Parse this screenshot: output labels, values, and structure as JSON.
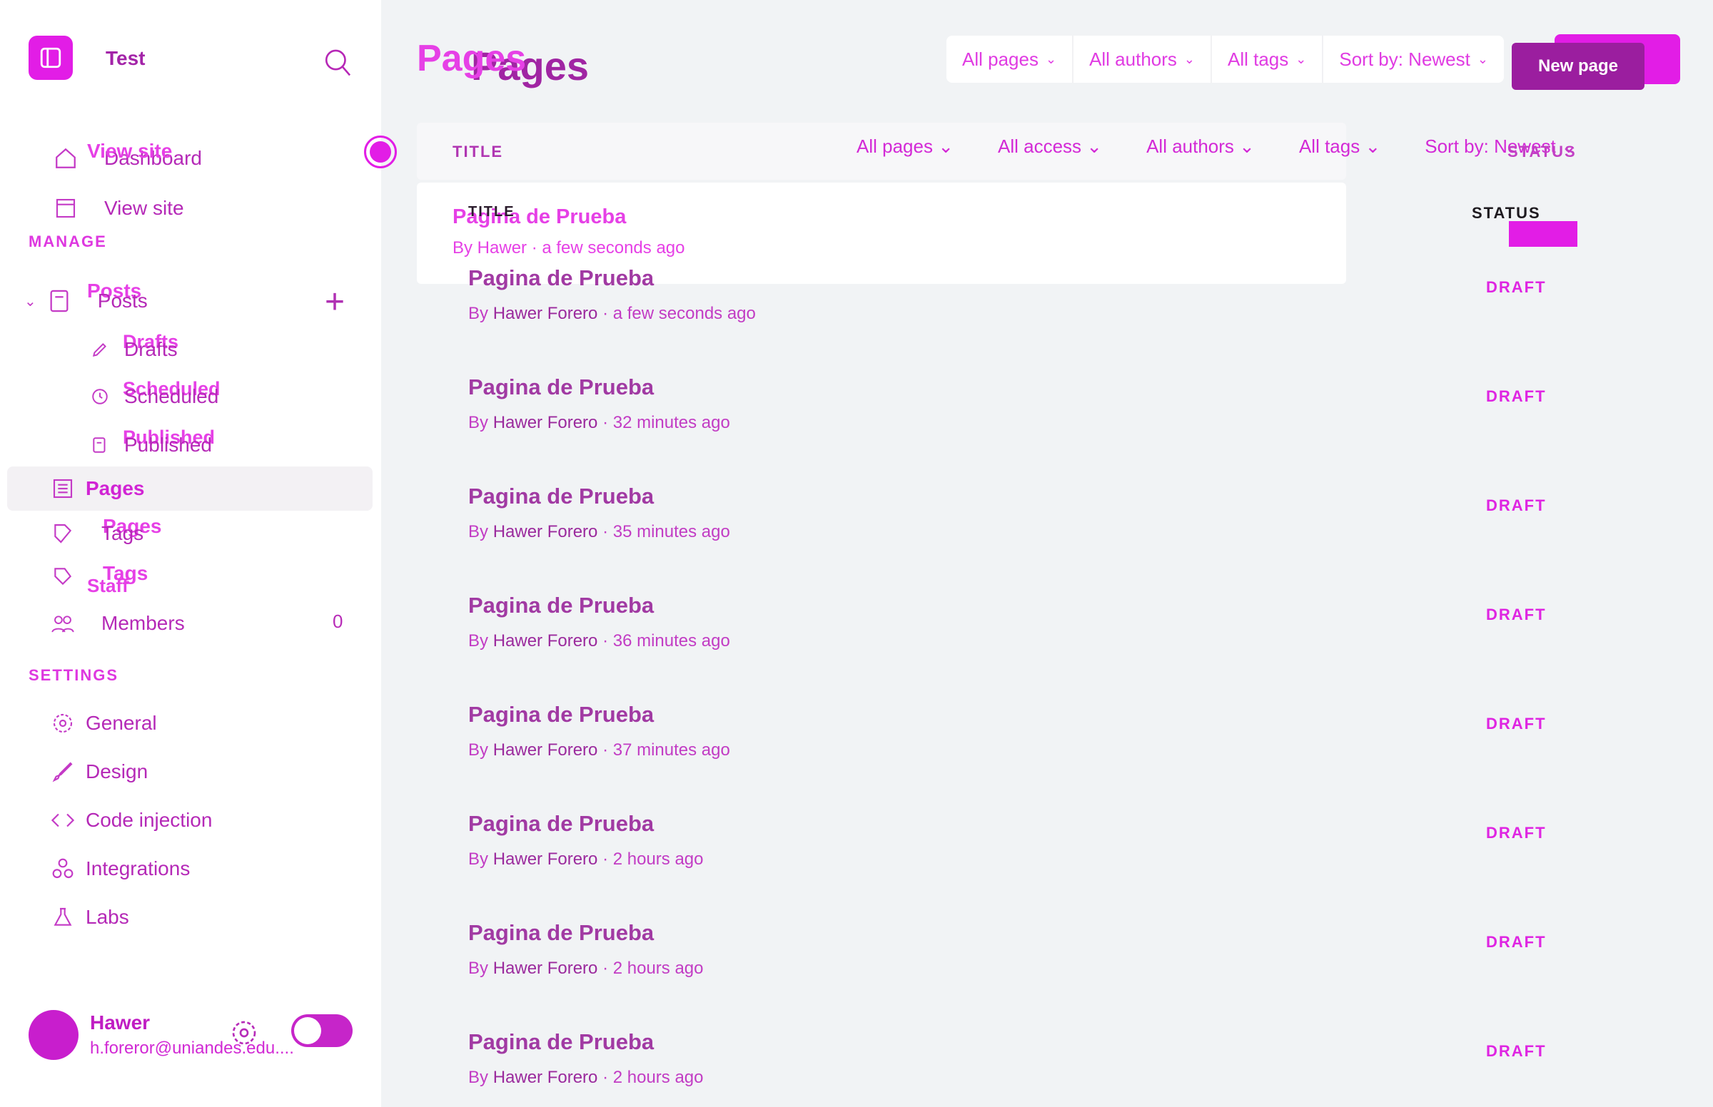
{
  "brand": {
    "name": "Test"
  },
  "sidebar": {
    "nav": [
      {
        "label": "Dashboard"
      },
      {
        "label": "View site"
      }
    ],
    "manage_title": "MANAGE",
    "posts": {
      "label": "Posts",
      "sub": [
        {
          "label": "Drafts"
        },
        {
          "label": "Scheduled"
        },
        {
          "label": "Published"
        }
      ]
    },
    "manage": [
      {
        "label": "Pages"
      },
      {
        "label": "Tags"
      },
      {
        "label": "Members",
        "count": "0"
      }
    ],
    "settings_title": "SETTINGS",
    "settings": [
      {
        "label": "General"
      },
      {
        "label": "Design"
      },
      {
        "label": "Code injection"
      },
      {
        "label": "Integrations"
      },
      {
        "label": "Labs"
      }
    ],
    "ghost_labels": {
      "view_site": "View site",
      "posts": "Posts",
      "drafts": "Drafts",
      "scheduled": "Scheduled",
      "published": "Published",
      "pages": "Pages",
      "tags": "Tags",
      "staff": "Staff"
    },
    "user": {
      "name": "Hawer",
      "email": "h.foreror@uniandes.edu...."
    }
  },
  "main": {
    "title": "Pages",
    "filters": [
      "All pages",
      "All authors",
      "All tags",
      "Sort by: Newest"
    ],
    "new_button": "New page",
    "table_filters": [
      "All pages",
      "All access",
      "All authors",
      "All tags",
      "Sort by: Newest"
    ],
    "col_title": "TITLE",
    "col_status": "STATUS",
    "ghost_row": {
      "title": "Pagina de Prueba",
      "meta": "By Hawer · a few seconds ago"
    },
    "rows": [
      {
        "title": "Pagina de Prueba",
        "by": "By",
        "author": "Hawer Forero",
        "time": "· a few seconds ago",
        "status": "DRAFT"
      },
      {
        "title": "Pagina de Prueba",
        "by": "By",
        "author": "Hawer Forero",
        "time": "· 32 minutes ago",
        "status": "DRAFT"
      },
      {
        "title": "Pagina de Prueba",
        "by": "By",
        "author": "Hawer Forero",
        "time": "· 35 minutes ago",
        "status": "DRAFT"
      },
      {
        "title": "Pagina de Prueba",
        "by": "By",
        "author": "Hawer Forero",
        "time": "· 36 minutes ago",
        "status": "DRAFT"
      },
      {
        "title": "Pagina de Prueba",
        "by": "By",
        "author": "Hawer Forero",
        "time": "· 37 minutes ago",
        "status": "DRAFT"
      },
      {
        "title": "Pagina de Prueba",
        "by": "By",
        "author": "Hawer Forero",
        "time": "· 2 hours ago",
        "status": "DRAFT"
      },
      {
        "title": "Pagina de Prueba",
        "by": "By",
        "author": "Hawer Forero",
        "time": "· 2 hours ago",
        "status": "DRAFT"
      },
      {
        "title": "Pagina de Prueba",
        "by": "By",
        "author": "Hawer Forero",
        "time": "· 2 hours ago",
        "status": "DRAFT"
      }
    ]
  },
  "colors": {
    "accent": "#e21de6",
    "text": "#a324a8",
    "background": "#f1f3f5"
  }
}
